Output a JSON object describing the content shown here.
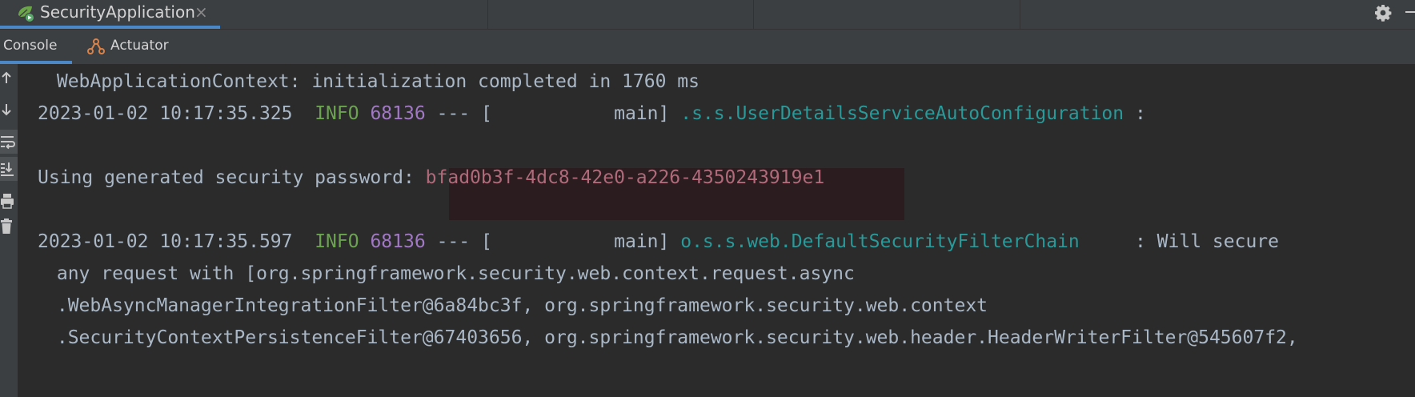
{
  "run_tab": {
    "title": "SecurityApplication",
    "close_glyph": "×",
    "icon": "spring-boot-run-icon"
  },
  "toolbar_right": {
    "settings_icon": "gear-icon",
    "minimize_icon": "minimize-icon"
  },
  "sub_tabs": [
    {
      "label": "Console",
      "active": true
    },
    {
      "label": "Actuator",
      "icon": "actuator-icon",
      "active": false
    }
  ],
  "gutter_tools": [
    {
      "name": "up-arrow-icon",
      "active": false
    },
    {
      "name": "down-arrow-icon",
      "active": false
    },
    {
      "name": "soft-wrap-icon",
      "active": true
    },
    {
      "name": "scroll-to-end-icon",
      "active": true
    },
    {
      "name": "print-icon",
      "active": false
    },
    {
      "name": "clear-all-icon",
      "active": false
    }
  ],
  "console": {
    "line1": " WebApplicationContext: initialization completed in 1760 ms",
    "line2": {
      "timestamp": "2023-01-02 10:17:35.325",
      "level": "INFO",
      "pid": "68136",
      "sep": "--- [",
      "thread": "           main]",
      "logger": ".s.s.UserDetailsServiceAutoConfiguration",
      "tail": ":"
    },
    "line3": {
      "prefix": "Using generated security password:",
      "password": "bfad0b3f-4dc8-42e0-a226-4350243919e1"
    },
    "line4": {
      "timestamp": "2023-01-02 10:17:35.597",
      "level": "INFO",
      "pid": "68136",
      "sep": "--- [",
      "thread": "           main]",
      "logger": "o.s.s.web.DefaultSecurityFilterChain",
      "tail": ": Will secure"
    },
    "line5": " any request with [org.springframework.security.web.context.request.async",
    "line6": " .WebAsyncManagerIntegrationFilter@6a84bc3f, org.springframework.security.web.context",
    "line7": " .SecurityContextPersistenceFilter@67403656, org.springframework.security.web.header.HeaderWriterFilter@545607f2,"
  },
  "colors": {
    "tab_underline": "#4a88c7",
    "info": "#6ca351",
    "pid": "#a178c4",
    "logger": "#299999",
    "password": "#b06a7a",
    "password_bg": "#2a1c1f"
  }
}
